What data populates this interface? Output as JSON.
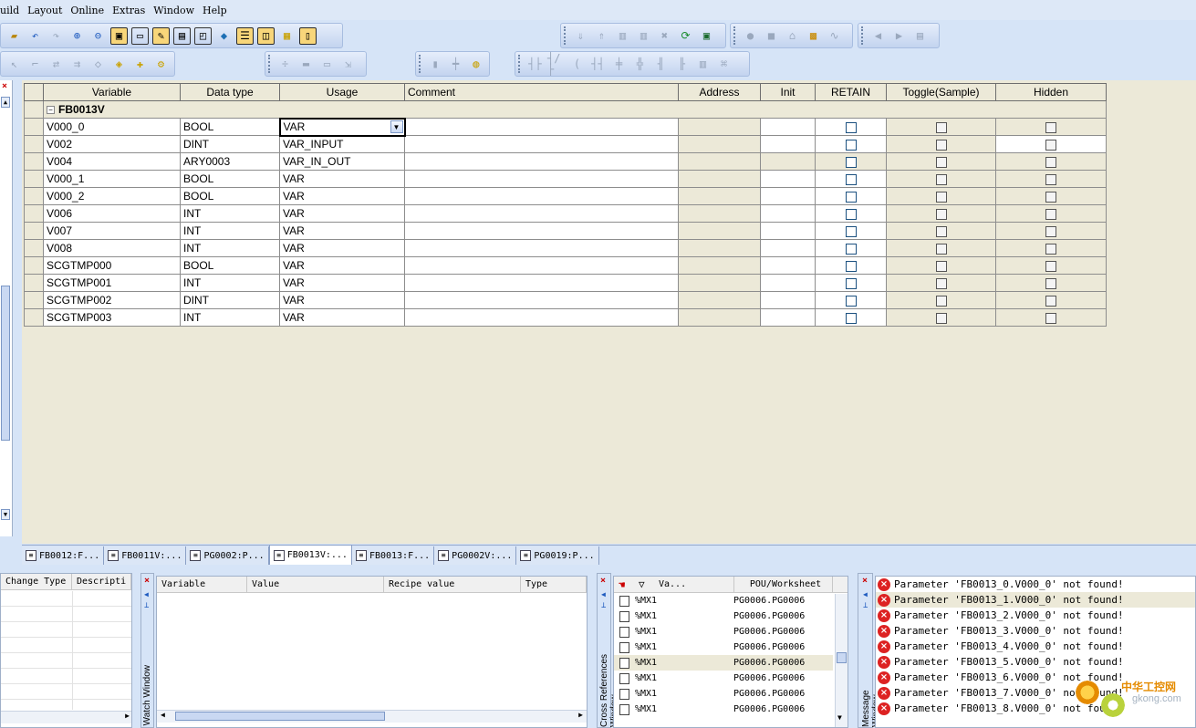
{
  "menu": [
    "uild",
    "Layout",
    "Online",
    "Extras",
    "Window",
    "Help"
  ],
  "grid": {
    "columns": [
      "Variable",
      "Data type",
      "Usage",
      "Comment",
      "Address",
      "Init",
      "RETAIN",
      "Toggle(Sample)",
      "Hidden"
    ],
    "group": "FB0013V",
    "group_toggle": "−",
    "dropdown_glyph": "▼",
    "rows": [
      {
        "variable": "V000_0",
        "type": "BOOL",
        "usage": "VAR"
      },
      {
        "variable": "V002",
        "type": "DINT",
        "usage": "VAR_INPUT"
      },
      {
        "variable": "V004",
        "type": "ARY0003",
        "usage": "VAR_IN_OUT"
      },
      {
        "variable": "V000_1",
        "type": "BOOL",
        "usage": "VAR"
      },
      {
        "variable": "V000_2",
        "type": "BOOL",
        "usage": "VAR"
      },
      {
        "variable": "V006",
        "type": "INT",
        "usage": "VAR"
      },
      {
        "variable": "V007",
        "type": "INT",
        "usage": "VAR"
      },
      {
        "variable": "V008",
        "type": "INT",
        "usage": "VAR"
      },
      {
        "variable": "SCGTMP000",
        "type": "BOOL",
        "usage": "VAR"
      },
      {
        "variable": "SCGTMP001",
        "type": "INT",
        "usage": "VAR"
      },
      {
        "variable": "SCGTMP002",
        "type": "DINT",
        "usage": "VAR"
      },
      {
        "variable": "SCGTMP003",
        "type": "INT",
        "usage": "VAR"
      }
    ]
  },
  "tabs": [
    "FB0012:F...",
    "FB0011V:...",
    "PG0002:P...",
    "FB0013V:...",
    "FB0013:F...",
    "PG0002V:...",
    "PG0019:P..."
  ],
  "active_tab_index": 3,
  "left_bottom": {
    "columns": [
      "Change Type",
      "Descripti"
    ]
  },
  "watch": {
    "title": "Watch Window",
    "columns": [
      "Variable",
      "Value",
      "Recipe value",
      "Type"
    ]
  },
  "xref": {
    "title": "Cross References Window",
    "columns": [
      "Va...",
      "POU/Worksheet"
    ],
    "rows": [
      {
        "var": "%MX1",
        "pou": "PG0006.PG0006"
      },
      {
        "var": "%MX1",
        "pou": "PG0006.PG0006"
      },
      {
        "var": "%MX1",
        "pou": "PG0006.PG0006"
      },
      {
        "var": "%MX1",
        "pou": "PG0006.PG0006"
      },
      {
        "var": "%MX1",
        "pou": "PG0006.PG0006"
      },
      {
        "var": "%MX1",
        "pou": "PG0006.PG0006"
      },
      {
        "var": "%MX1",
        "pou": "PG0006.PG0006"
      },
      {
        "var": "%MX1",
        "pou": "PG0006.PG0006"
      }
    ]
  },
  "messages": {
    "title": "Message Window",
    "items": [
      "Parameter 'FB0013_0.V000_0' not found!",
      "Parameter 'FB0013_1.V000_0' not found!",
      "Parameter 'FB0013_2.V000_0' not found!",
      "Parameter 'FB0013_3.V000_0' not found!",
      "Parameter 'FB0013_4.V000_0' not found!",
      "Parameter 'FB0013_5.V000_0' not found!",
      "Parameter 'FB0013_6.V000_0' not found!",
      "Parameter 'FB0013_7.V000_0' not found!",
      "Parameter 'FB0013_8.V000_0' not found!"
    ]
  },
  "watermark": {
    "line1": "中华工控网",
    "line2": "gkong.com"
  },
  "glyphs": {
    "close": "×",
    "error": "×",
    "left": "◀",
    "right": "▶",
    "up": "▲",
    "down": "▼",
    "pin": "⊥"
  },
  "colors": {
    "grid_bg": "#ece9d8",
    "chrome": "#d6e4f7",
    "error": "#d22222"
  }
}
